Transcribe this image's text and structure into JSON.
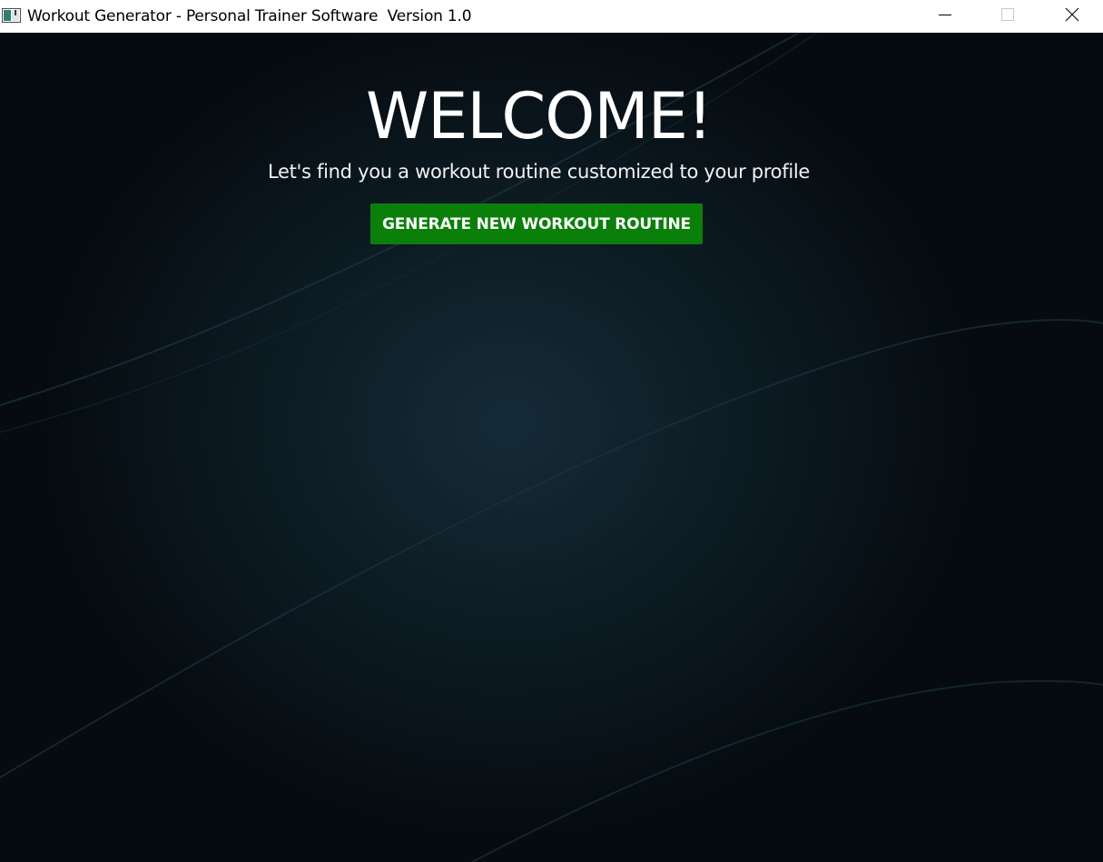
{
  "window": {
    "title": "Workout Generator - Personal Trainer Software  Version 1.0",
    "icon": "app-window-icon",
    "controls": {
      "minimize_icon": "minimize-icon",
      "maximize_icon": "maximize-icon",
      "close_icon": "close-icon"
    }
  },
  "main": {
    "heading": "WELCOME!",
    "subtitle": "Let's find you a workout routine customized to your profile",
    "generate_button_label": "GENERATE NEW WORKOUT ROUTINE"
  },
  "colors": {
    "background_dark": "#050b0f",
    "background_center": "#152b38",
    "button_green": "#0a7f0a",
    "text": "#ffffff"
  }
}
